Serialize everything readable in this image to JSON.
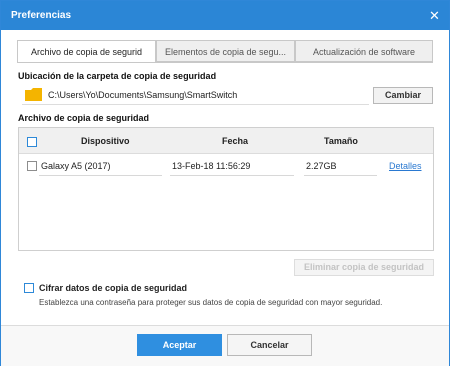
{
  "window": {
    "title": "Preferencias",
    "close_icon": "close-icon"
  },
  "tabs": [
    {
      "label": "Archivo de copia de segurid"
    },
    {
      "label": "Elementos de copia de segu..."
    },
    {
      "label": "Actualización de software"
    }
  ],
  "backup_folder": {
    "label": "Ubicación de la carpeta de copia de seguridad",
    "path": "C:\\Users\\Yo\\Documents\\Samsung\\SmartSwitch",
    "change_button": "Cambiar",
    "folder_icon": "folder-icon"
  },
  "backup_files": {
    "label": "Archivo de copia de seguridad",
    "headers": [
      "Dispositivo",
      "Fecha",
      "Tamaño"
    ],
    "rows": [
      {
        "device": "Galaxy A5 (2017)",
        "date": "13-Feb-18 11:56:29",
        "size": "2.27GB",
        "details": "Detalles"
      }
    ],
    "delete_button": "Eliminar copia de seguridad"
  },
  "encryption": {
    "label": "Cifrar datos de copia de seguridad",
    "description": "Establezca una contraseña para proteger sus datos de copia de seguridad con mayor seguridad."
  },
  "footer": {
    "accept": "Aceptar",
    "cancel": "Cancelar"
  },
  "colors": {
    "accent": "#2b86d6",
    "folder": "#f4b400",
    "link": "#2a79d1"
  }
}
